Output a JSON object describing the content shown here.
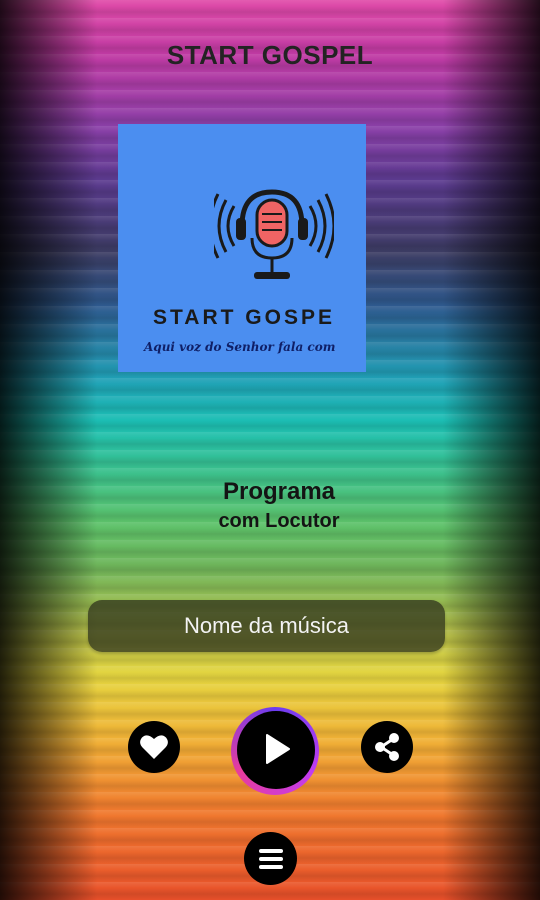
{
  "app": {
    "title": "START GOSPEL"
  },
  "cover": {
    "logo_text": "START GOSPE",
    "tagline": "Aqui voz do Senhor fala com"
  },
  "program": {
    "line1": "Programa",
    "line2": "com Locutor"
  },
  "song": {
    "name": "Nome da música"
  },
  "controls": {
    "like": "heart-icon",
    "play": "play-icon",
    "share": "share-icon",
    "menu": "menu-icon"
  },
  "colors": {
    "cover_bg": "#4b8ef0",
    "mic_accent": "#f06464",
    "song_bar_bg": "#32371e",
    "button_bg": "#000000"
  }
}
